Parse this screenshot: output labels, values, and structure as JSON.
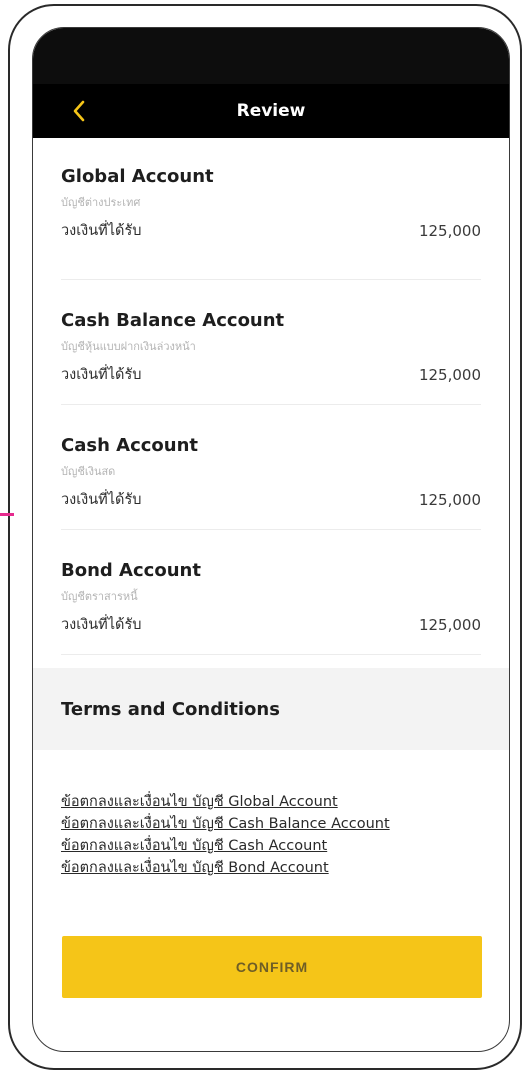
{
  "header": {
    "title": "Review",
    "back_icon": "chevron-left-icon",
    "back_glyph": "‹"
  },
  "accounts": [
    {
      "name": "Global Account",
      "subtitle": "บัญชีต่างประเทศ",
      "limit_label": "วงเงินที่ได้รับ",
      "limit_value": "125,000"
    },
    {
      "name": "Cash Balance Account",
      "subtitle": "บัญชีหุ้นแบบฝากเงินล่วงหน้า",
      "limit_label": "วงเงินที่ได้รับ",
      "limit_value": "125,000"
    },
    {
      "name": "Cash Account",
      "subtitle": "บัญชีเงินสด",
      "limit_label": "วงเงินที่ได้รับ",
      "limit_value": "125,000"
    },
    {
      "name": "Bond Account",
      "subtitle": "บัญชีตราสารหนี้",
      "limit_label": "วงเงินที่ได้รับ",
      "limit_value": "125,000"
    }
  ],
  "terms": {
    "title": "Terms and Conditions",
    "links": [
      "ข้อตกลงและเงื่อนไข บัญชี Global Account",
      "ข้อตกลงและเงื่อนไข บัญชี Cash Balance Account",
      "ข้อตกลงและเงื่อนไข บัญชี Cash Account",
      "ข้อตกลงและเงื่อนไข บัญชี Bond Account"
    ]
  },
  "confirm_label": "CONFIRM",
  "colors": {
    "accent": "#f5c518",
    "back_arrow": "#f5c518",
    "header_bg": "#000000",
    "terms_band": "#f3f3f3"
  }
}
